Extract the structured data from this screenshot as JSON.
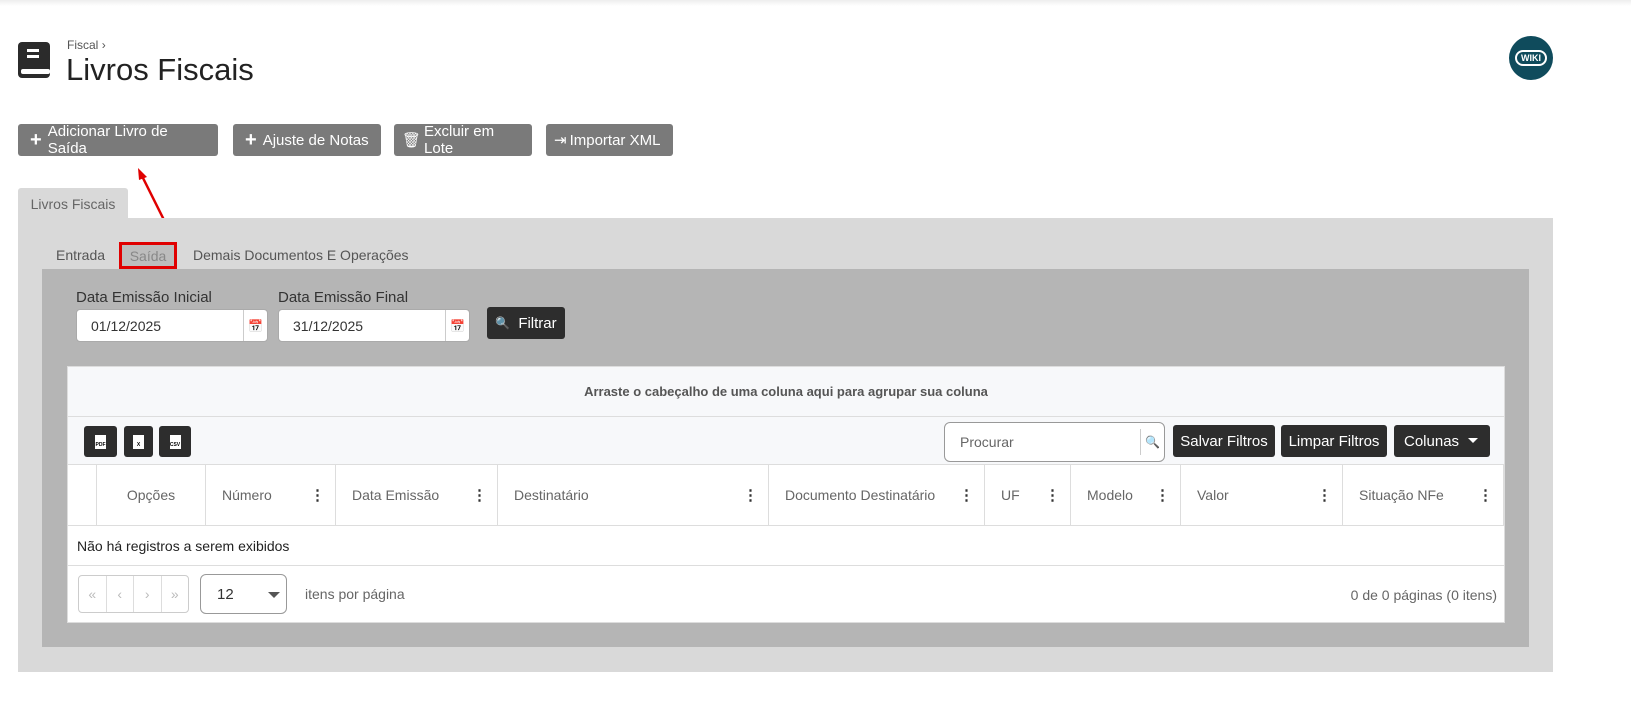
{
  "header": {
    "breadcrumb": "Fiscal",
    "breadcrumb_sep": "›",
    "title": "Livros Fiscais",
    "wiki": "WIKI"
  },
  "actions": [
    {
      "label": "Adicionar Livro de Saída",
      "icon": "plus"
    },
    {
      "label": "Ajuste de Notas",
      "icon": "plus"
    },
    {
      "label": "Excluir em Lote",
      "icon": "trash"
    },
    {
      "label": "Importar XML",
      "icon": "file-import"
    }
  ],
  "panel_tab": "Livros Fiscais",
  "subtabs": [
    "Entrada",
    "Saída",
    "Demais Documentos E Operações"
  ],
  "filters": {
    "start_label": "Data Emissão Inicial",
    "start_value": "01/12/2025",
    "end_label": "Data Emissão Final",
    "end_value": "31/12/2025",
    "filter_button": "Filtrar"
  },
  "grid": {
    "group_hint": "Arraste o cabeçalho de uma coluna aqui para agrupar sua coluna",
    "export": [
      "PDF",
      "X",
      "CSV"
    ],
    "search_placeholder": "Procurar",
    "save_filters": "Salvar Filtros",
    "clear_filters": "Limpar Filtros",
    "columns": "Colunas",
    "headers": [
      "Opções",
      "Número",
      "Data Emissão",
      "Destinatário",
      "Documento Destinatário",
      "UF",
      "Modelo",
      "Valor",
      "Situação NFe"
    ],
    "empty": "Não há registros a serem exibidos",
    "page_size": "12",
    "page_size_label": "itens por página",
    "page_info": "0 de 0 páginas (0 itens)"
  },
  "colors": {
    "annotation": "#e00000",
    "button_gray": "#7a7a7a",
    "dark_button": "#2d2d2d",
    "wiki": "#0f4b5c"
  }
}
